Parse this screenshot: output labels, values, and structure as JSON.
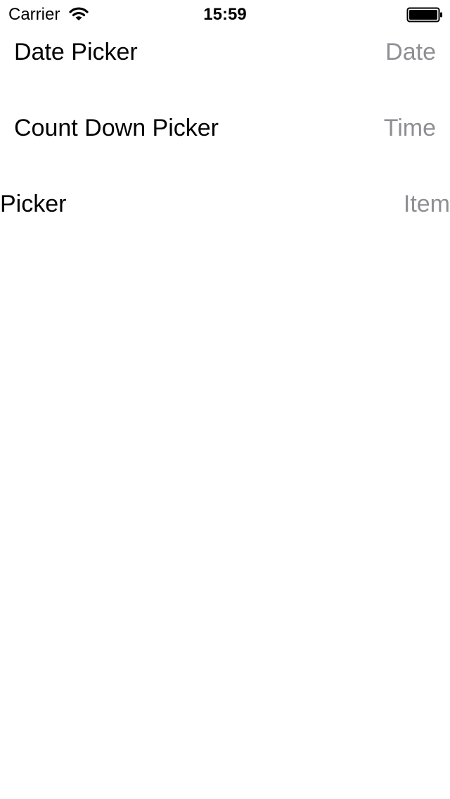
{
  "status_bar": {
    "carrier": "Carrier",
    "time": "15:59",
    "icons": [
      "wifi-icon",
      "battery-icon"
    ]
  },
  "rows": [
    {
      "label": "Date Picker",
      "value": "Date"
    },
    {
      "label": "Count Down Picker",
      "value": "Time"
    },
    {
      "label": "Picker",
      "value": "Item"
    }
  ],
  "colors": {
    "background": "#ffffff",
    "label": "#000000",
    "detail": "#8e8e93"
  }
}
